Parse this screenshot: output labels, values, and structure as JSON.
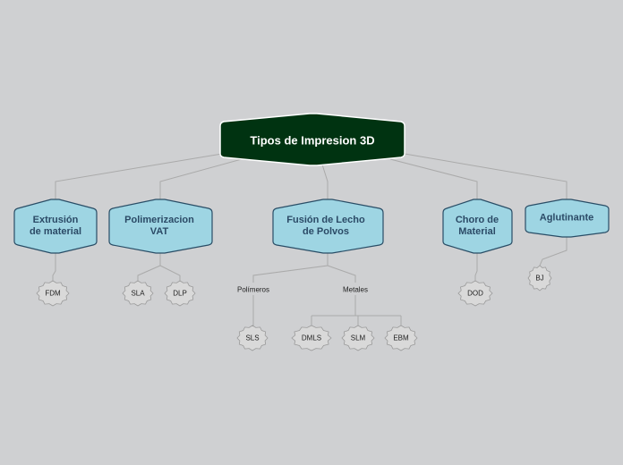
{
  "diagram": {
    "root": "Tipos de Impresion 3D",
    "categories": [
      {
        "key": "extrusion",
        "label": "Extrusión\nde material"
      },
      {
        "key": "vat",
        "label": "Polimerizacion\nVAT"
      },
      {
        "key": "fusion",
        "label": "Fusión de Lecho\nde Polvos"
      },
      {
        "key": "choro",
        "label": "Choro de\nMaterial"
      },
      {
        "key": "aglutinante",
        "label": "Aglutinante"
      }
    ],
    "groups": [
      {
        "key": "polimeros",
        "label": "Polímeros"
      },
      {
        "key": "metales",
        "label": "Metales"
      }
    ],
    "leaves": [
      {
        "key": "fdm",
        "label": "FDM"
      },
      {
        "key": "sla",
        "label": "SLA"
      },
      {
        "key": "dlp",
        "label": "DLP"
      },
      {
        "key": "sls",
        "label": "SLS"
      },
      {
        "key": "dmls",
        "label": "DMLS"
      },
      {
        "key": "slm",
        "label": "SLM"
      },
      {
        "key": "ebm",
        "label": "EBM"
      },
      {
        "key": "dod",
        "label": "DOD"
      },
      {
        "key": "bj",
        "label": "BJ"
      }
    ],
    "colors": {
      "background": "#cfd0d2",
      "root_fill": "#003311",
      "node_fill": "#9ed5e3",
      "node_stroke": "#294d66",
      "connector": "#aaaaaa",
      "leaf_fill": "#d9d9d9"
    }
  }
}
